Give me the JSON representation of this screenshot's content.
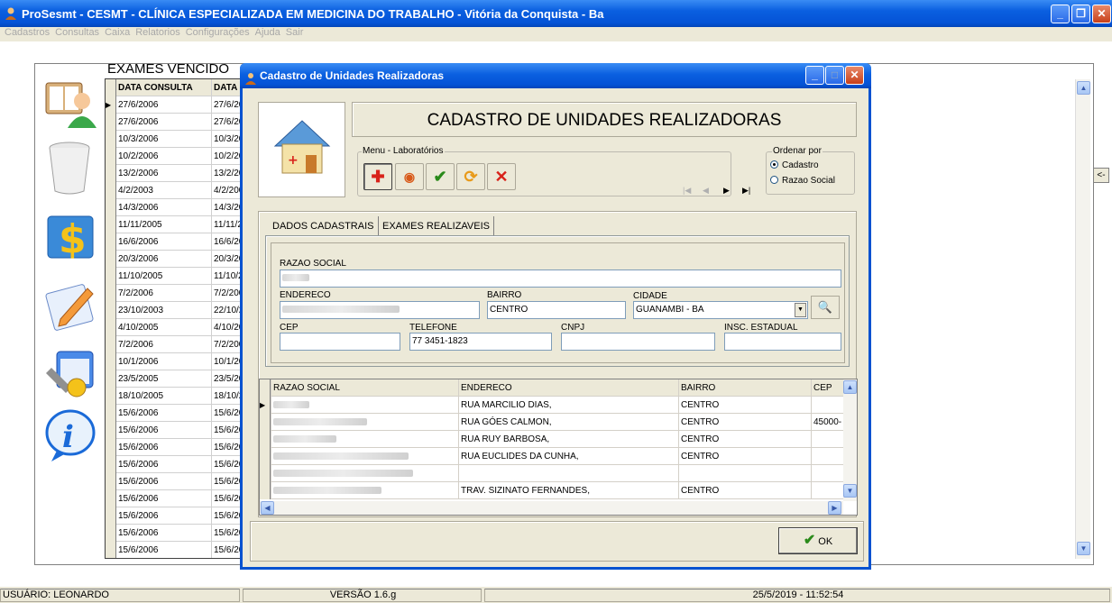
{
  "window": {
    "title": "ProSesmt - CESMT - CLÍNICA ESPECIALIZADA EM MEDICINA DO TRABALHO - Vitória da Conquista - Ba",
    "minimize": "_",
    "maximize": "❐",
    "close": "✕"
  },
  "menu": [
    "Cadastros",
    "Consultas",
    "Caixa",
    "Relatorios",
    "Configurações",
    "Ajuda",
    "Sair"
  ],
  "exams": {
    "title": "EXAMES VENCIDO",
    "col1": "DATA CONSULTA",
    "col2": "DATA",
    "rows": [
      [
        "27/6/2006",
        "27/6/20"
      ],
      [
        "27/6/2006",
        "27/6/20"
      ],
      [
        "10/3/2006",
        "10/3/20"
      ],
      [
        "10/2/2006",
        "10/2/20"
      ],
      [
        "13/2/2006",
        "13/2/20"
      ],
      [
        "4/2/2003",
        "4/2/200"
      ],
      [
        "14/3/2006",
        "14/3/20"
      ],
      [
        "11/11/2005",
        "11/11/2"
      ],
      [
        "16/6/2006",
        "16/6/20"
      ],
      [
        "20/3/2006",
        "20/3/20"
      ],
      [
        "11/10/2005",
        "11/10/2"
      ],
      [
        "7/2/2006",
        "7/2/200"
      ],
      [
        "23/10/2003",
        "22/10/2"
      ],
      [
        "4/10/2005",
        "4/10/20"
      ],
      [
        "7/2/2006",
        "7/2/200"
      ],
      [
        "10/1/2006",
        "10/1/20"
      ],
      [
        "23/5/2005",
        "23/5/20"
      ],
      [
        "18/10/2005",
        "18/10/2"
      ],
      [
        "15/6/2006",
        "15/6/20"
      ],
      [
        "15/6/2006",
        "15/6/20"
      ],
      [
        "15/6/2006",
        "15/6/20"
      ],
      [
        "15/6/2006",
        "15/6/20"
      ],
      [
        "15/6/2006",
        "15/6/20"
      ],
      [
        "15/6/2006",
        "15/6/20"
      ],
      [
        "15/6/2006",
        "15/6/20"
      ],
      [
        "15/6/2006",
        "15/6/20"
      ],
      [
        "15/6/2006",
        "15/6/20"
      ]
    ]
  },
  "back_button": "<-",
  "status": {
    "user": "USUÁRIO: LEONARDO",
    "version": "VERSÃO 1.6.g",
    "datetime": "25/5/2019 - 11:52:54"
  },
  "dialog": {
    "title": "Cadastro de Unidades Realizadoras",
    "heading": "CADASTRO DE UNIDADES REALIZADORAS",
    "menu_group": "Menu - Laboratórios",
    "order_group": "Ordenar por",
    "order_options": [
      "Cadastro",
      "Razao Social"
    ],
    "tabs": [
      "DADOS CADASTRAIS",
      "EXAMES REALIZAVEIS"
    ],
    "fields": {
      "razao_social_label": "RAZAO SOCIAL",
      "endereco_label": "ENDERECO",
      "bairro_label": "BAIRRO",
      "bairro_value": "CENTRO",
      "cidade_label": "CIDADE",
      "cidade_value": "GUANAMBI - BA",
      "cep_label": "CEP",
      "telefone_label": "TELEFONE",
      "telefone_value": "77 3451-1823",
      "cnpj_label": "CNPJ",
      "insc_label": "INSC. ESTADUAL"
    },
    "grid": {
      "headers": [
        "RAZAO SOCIAL",
        "ENDERECO",
        "BAIRRO",
        "CEP"
      ],
      "rows": [
        {
          "end": "RUA MARCILIO DIAS,",
          "bairro": "CENTRO",
          "cep": ""
        },
        {
          "end": "RUA  GÓES CALMON,",
          "bairro": "CENTRO",
          "cep": "45000-"
        },
        {
          "end": "RUA RUY BARBOSA,",
          "bairro": "CENTRO",
          "cep": ""
        },
        {
          "end": "RUA EUCLIDES DA CUNHA,",
          "bairro": "CENTRO",
          "cep": ""
        },
        {
          "end": "",
          "bairro": "",
          "cep": ""
        },
        {
          "end": "TRAV. SIZINATO FERNANDES,",
          "bairro": "CENTRO",
          "cep": ""
        }
      ]
    },
    "ok_label": "OK"
  },
  "colors": {
    "titlebar": "#0553d6",
    "face": "#ece9d8",
    "accent_red": "#d8221a",
    "accent_green": "#2a8a1a"
  }
}
